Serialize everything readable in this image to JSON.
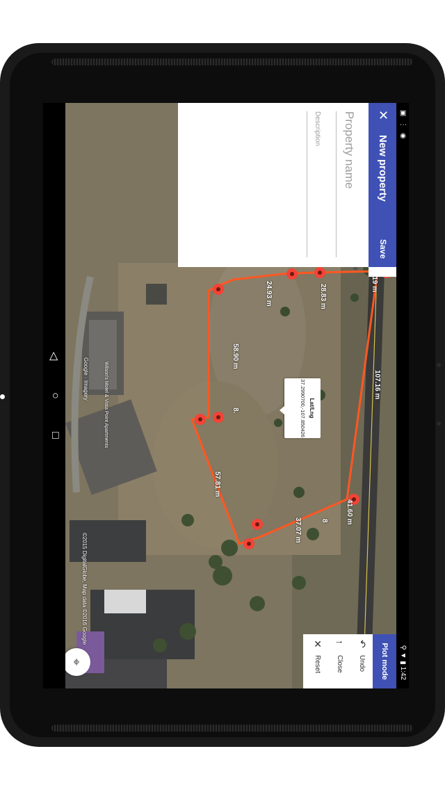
{
  "statusbar": {
    "left_icons": "▣ ⋮ ◉",
    "right": "⚲ ▼ ▮ 1:42"
  },
  "appbar": {
    "close_icon": "close-icon",
    "title": "New property",
    "save_label": "Save"
  },
  "form": {
    "name_placeholder": "Property name",
    "description_placeholder": "Description"
  },
  "plot": {
    "header": "Plot mode",
    "undo_label": "Undo",
    "close_label": "Close",
    "reset_label": "Reset"
  },
  "tooltip": {
    "title": "Lat/Lng",
    "value": "37.2990700,-107.850426"
  },
  "measurements": {
    "m1": "11.19 m",
    "m2": "28.83 m",
    "m3": "24.93 m",
    "m4": "58.90 m",
    "m5": "8.",
    "m6": "57.81 m",
    "m7": "37.07 m",
    "m8": "8",
    "m9": "41.60 m",
    "m10": "107.16 m"
  },
  "map": {
    "copyright": "©2015 DigitalGlobe, Map data ©2016 Google",
    "google": "Google · Imagery",
    "business_label": "Wilson's Motel & Vista Point Apartments"
  },
  "navbar": {
    "back": "◁",
    "home": "○",
    "recents": "□"
  },
  "colors": {
    "primary": "#3f51b5",
    "polygon": "#ff5722",
    "marker": "#f44336"
  }
}
